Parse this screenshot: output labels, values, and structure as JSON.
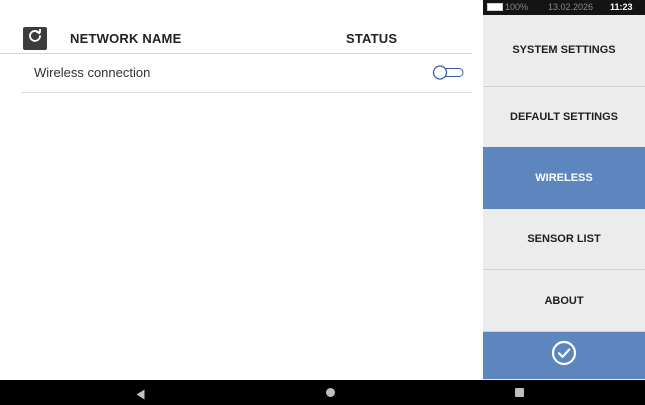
{
  "header": {
    "col_network_name": "NETWORK NAME",
    "col_status": "STATUS"
  },
  "rows": [
    {
      "label": "Wireless connection",
      "toggle": "off"
    }
  ],
  "status_bar": {
    "battery": "100%",
    "date": "13.02.2026",
    "time": "11:23"
  },
  "sidebar": {
    "items": [
      {
        "label": "SYSTEM SETTINGS",
        "active": false
      },
      {
        "label": "DEFAULT SETTINGS",
        "active": false
      },
      {
        "label": "WIRELESS",
        "active": true
      },
      {
        "label": "SENSOR LIST",
        "active": false
      },
      {
        "label": "ABOUT",
        "active": false
      }
    ]
  },
  "icons": {
    "refresh": "refresh-icon",
    "confirm": "check-circle-icon",
    "back": "back-triangle-icon",
    "home": "home-circle-icon",
    "recent": "recent-square-icon"
  },
  "colors": {
    "accent": "#5d86bf",
    "sidebar_bg": "#ececec",
    "statusbar_bg": "#141414"
  }
}
